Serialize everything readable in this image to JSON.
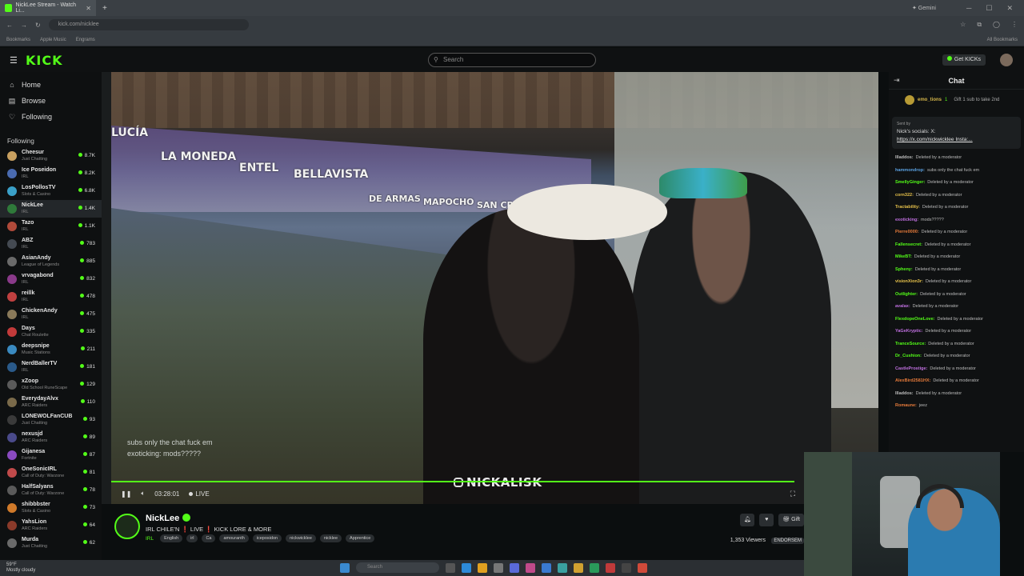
{
  "browser": {
    "tab_title": "NickLee Stream - Watch Li...",
    "tab_close": "✕",
    "new_tab": "+",
    "gemini": "✦ Gemini",
    "url": "kick.com/nicklee",
    "bookmarks": [
      "Bookmarks",
      "Apple Music",
      "Engrams"
    ],
    "all_bookmarks": "All Bookmarks"
  },
  "header": {
    "logo": "KICK",
    "search_placeholder": "Search",
    "get_kicks": "Get KICKs"
  },
  "sidebar": {
    "nav": [
      {
        "label": "Home",
        "icon": "home-icon"
      },
      {
        "label": "Browse",
        "icon": "browse-icon"
      },
      {
        "label": "Following",
        "icon": "heart-icon"
      }
    ],
    "following_title": "Following",
    "channels": [
      {
        "name": "Cheesur",
        "category": "Just Chatting",
        "viewers": "8.7K",
        "color": "#c8a060"
      },
      {
        "name": "Ice Poseidon",
        "category": "IRL",
        "viewers": "8.2K",
        "color": "#4a6bb0"
      },
      {
        "name": "LosPollosTV",
        "category": "Slots & Casino",
        "viewers": "6.8K",
        "color": "#3aa0c8"
      },
      {
        "name": "NickLee",
        "category": "IRL",
        "viewers": "1.4K",
        "color": "#2f7a3a"
      },
      {
        "name": "Tazo",
        "category": "IRL",
        "viewers": "1.1K",
        "color": "#b04a3a"
      },
      {
        "name": "ABZ",
        "category": "IRL",
        "viewers": "783",
        "color": "#444a52"
      },
      {
        "name": "AsianAndy",
        "category": "League of Legends",
        "viewers": "885",
        "color": "#6a6a6a"
      },
      {
        "name": "vrvagabond",
        "category": "IRL",
        "viewers": "832",
        "color": "#8a3a8a"
      },
      {
        "name": "reillk",
        "category": "IRL",
        "viewers": "478",
        "color": "#c04040"
      },
      {
        "name": "ChickenAndy",
        "category": "IRL",
        "viewers": "475",
        "color": "#8a7a5a"
      },
      {
        "name": "Days",
        "category": "Chat Roulette",
        "viewers": "335",
        "color": "#c23a3a"
      },
      {
        "name": "deepsnipe",
        "category": "Music Stations",
        "viewers": "211",
        "color": "#3a8ac0"
      },
      {
        "name": "NerdBallerTV",
        "category": "IRL",
        "viewers": "181",
        "color": "#2a5a8a"
      },
      {
        "name": "xZoop",
        "category": "Old School RuneScape",
        "viewers": "129",
        "color": "#5a5a5a"
      },
      {
        "name": "EverydayAlvx",
        "category": "ARC Raiders",
        "viewers": "110",
        "color": "#7a6a4a"
      },
      {
        "name": "LONEWOLFanCUB",
        "category": "Just Chatting",
        "viewers": "93",
        "color": "#3a3a3a"
      },
      {
        "name": "nexusjd",
        "category": "ARC Raiders",
        "viewers": "89",
        "color": "#4a4a8a"
      },
      {
        "name": "Gijanesa",
        "category": "Fortnite",
        "viewers": "87",
        "color": "#8a4ac0"
      },
      {
        "name": "OneSonicIRL",
        "category": "Call of Duty: Warzone",
        "viewers": "81",
        "color": "#c04a4a"
      },
      {
        "name": "HalfSalyans",
        "category": "Call of Duty: Warzone",
        "viewers": "78",
        "color": "#5a5a5a"
      },
      {
        "name": "shibbbster",
        "category": "Slots & Casino",
        "viewers": "73",
        "color": "#d07a2a"
      },
      {
        "name": "YahsLion",
        "category": "ARC Raiders",
        "viewers": "64",
        "color": "#8a3a2a"
      },
      {
        "name": "Murda",
        "category": "Just Chatting",
        "viewers": "62",
        "color": "#6a6a6a"
      }
    ]
  },
  "video": {
    "places": [
      "LUCÍA",
      "LA MONEDA",
      "ENTEL",
      "BELLAVISTA",
      "DE ARMAS",
      "MAPOCHO",
      "SAN CRISTÓBAL"
    ],
    "overlay_chat": [
      "subs only the chat fuck em",
      "exoticking: mods?????"
    ],
    "watermark": "NICKALISK",
    "time": "03:28:01",
    "live": "LIVE",
    "progress": 0.89
  },
  "stream": {
    "streamer": "NickLee",
    "title": "IRL CHILE'N ❗ LIVE ❗ KICK LORE & MORE",
    "category": "IRL",
    "tags": [
      "English",
      "irl",
      "Ca",
      "amouranth",
      "iceposidon",
      "nickwicklee",
      "nicklee",
      "Apprentice"
    ],
    "viewers": "1,353 Viewers",
    "gift": "Gift",
    "endorsement": "ENDORSEM"
  },
  "chat": {
    "title": "Chat",
    "gifter_name": "emo_tions",
    "gifter_count": "1",
    "gifter_note": "Gift 1 sub to take 2nd",
    "pinned_by": "Sent by",
    "pinned_text": "Nick's socials: X:",
    "pinned_link": "https://x.com/nickwicklee Insta:...",
    "messages": [
      {
        "user": "Illaddos:",
        "text": "Deleted by a moderator",
        "color": "#bbbbbb"
      },
      {
        "user": "hammondrop:",
        "text": "subs only the chat fuck em",
        "color": "#5aa0e0"
      },
      {
        "user": "SmellyGinger:",
        "text": "Deleted by a moderator",
        "color": "#53fc18"
      },
      {
        "user": "corn322:",
        "text": "Deleted by a moderator",
        "color": "#e5c04a"
      },
      {
        "user": "Tractability:",
        "text": "Deleted by a moderator",
        "color": "#e5c04a"
      },
      {
        "user": "exoticking:",
        "text": "mods?????",
        "color": "#c070e0"
      },
      {
        "user": "Pierre0000:",
        "text": "Deleted by a moderator",
        "color": "#e57a3a"
      },
      {
        "user": "Fallensecret:",
        "text": "Deleted by a moderator",
        "color": "#53fc18"
      },
      {
        "user": "MikeBT:",
        "text": "Deleted by a moderator",
        "color": "#53fc18"
      },
      {
        "user": "Spheny:",
        "text": "Deleted by a moderator",
        "color": "#53fc18"
      },
      {
        "user": "visionXion3r:",
        "text": "Deleted by a moderator",
        "color": "#e5c04a"
      },
      {
        "user": "Outlighter:",
        "text": "Deleted by a moderator",
        "color": "#53fc18"
      },
      {
        "user": "avalax:",
        "text": "Deleted by a moderator",
        "color": "#c070e0"
      },
      {
        "user": "FlexdopeOneLove:",
        "text": "Deleted by a moderator",
        "color": "#53fc18"
      },
      {
        "user": "YaGeKryptic:",
        "text": "Deleted by a moderator",
        "color": "#c070e0"
      },
      {
        "user": "TranceSource:",
        "text": "Deleted by a moderator",
        "color": "#53fc18"
      },
      {
        "user": "Dr_Cushion:",
        "text": "Deleted by a moderator",
        "color": "#53fc18"
      },
      {
        "user": "CastleProstige:",
        "text": "Deleted by a moderator",
        "color": "#c070e0"
      },
      {
        "user": "AlexBird2581HX:",
        "text": "Deleted by a moderator",
        "color": "#e57a3a"
      },
      {
        "user": "Illaddos:",
        "text": "Deleted by a moderator",
        "color": "#bbbbbb"
      },
      {
        "user": "Romaune:",
        "text": "jeez",
        "color": "#e57a3a"
      }
    ]
  },
  "taskbar": {
    "temp": "59°F",
    "weather": "Mostly cloudy",
    "search": "Search"
  }
}
